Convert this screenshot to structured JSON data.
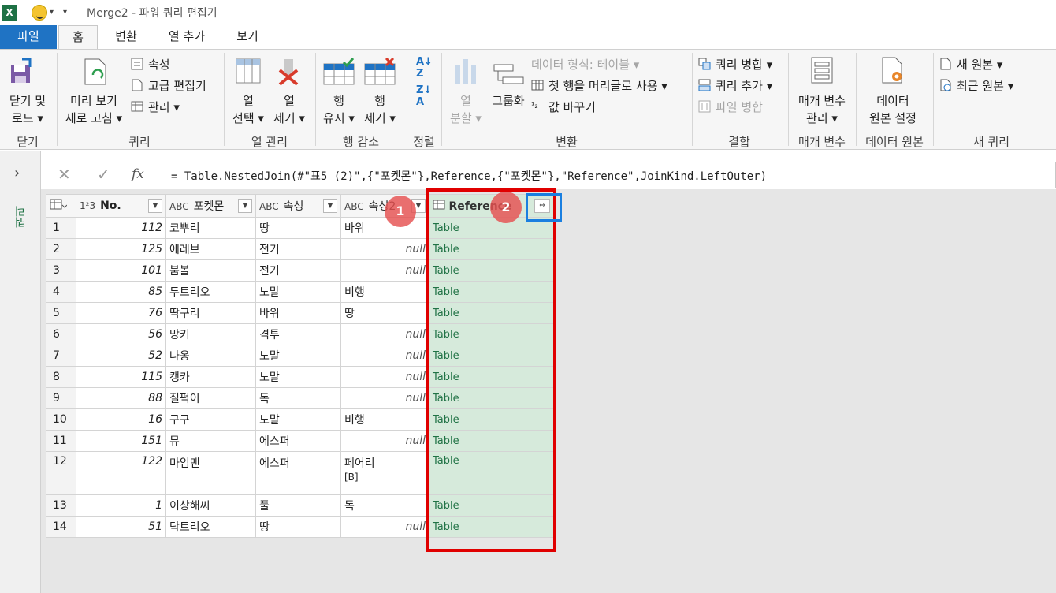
{
  "window": {
    "title": "Merge2 - 파워 쿼리 편집기"
  },
  "tabs": [
    {
      "label": "파일"
    },
    {
      "label": "홈"
    },
    {
      "label": "변환"
    },
    {
      "label": "열 추가"
    },
    {
      "label": "보기"
    }
  ],
  "ribbon": {
    "close_group": {
      "btn_line1": "닫기 및",
      "btn_line2": "로드 ▾",
      "label": "닫기"
    },
    "query_group": {
      "refresh_line1": "미리 보기",
      "refresh_line2": "새로 고침 ▾",
      "properties": "속성",
      "advanced_editor": "고급 편집기",
      "manage": "관리 ▾",
      "label": "쿼리"
    },
    "columns_group": {
      "choose_line1": "열",
      "choose_line2": "선택 ▾",
      "remove_line1": "열",
      "remove_line2": "제거 ▾",
      "label": "열 관리"
    },
    "rows_group": {
      "keep_line1": "행",
      "keep_line2": "유지 ▾",
      "remove_line1": "행",
      "remove_line2": "제거 ▾",
      "label": "행 감소"
    },
    "sort_group": {
      "label": "정렬"
    },
    "transform_group": {
      "split_line1": "열",
      "split_line2": "분할 ▾",
      "group_by": "그룹화",
      "data_type": "데이터 형식: 테이블 ▾",
      "first_row_headers": "첫 행을 머리글로 사용 ▾",
      "replace_values": "값 바꾸기",
      "label": "변환"
    },
    "combine_group": {
      "merge_queries": "쿼리 병합 ▾",
      "append_queries": "쿼리 추가 ▾",
      "combine_files": "파일 병합",
      "label": "결합"
    },
    "params_group": {
      "btn_line1": "매개 변수",
      "btn_line2": "관리 ▾",
      "label": "매개 변수"
    },
    "datasource_group": {
      "btn_line1": "데이터",
      "btn_line2": "원본 설정",
      "label": "데이터 원본"
    },
    "newquery_group": {
      "new_source": "새 원본 ▾",
      "recent_sources": "최근 원본 ▾",
      "label": "새 쿼리"
    }
  },
  "left_pane": {
    "label": "쿼리"
  },
  "formula_bar": {
    "fx": "fx",
    "formula": "= Table.NestedJoin(#\"표5 (2)\",{\"포켓몬\"},Reference,{\"포켓몬\"},\"Reference\",JoinKind.LeftOuter)"
  },
  "grid": {
    "columns": [
      {
        "type": "1²3",
        "name": "No."
      },
      {
        "type": "ABC",
        "name": "포켓몬"
      },
      {
        "type": "ABC",
        "name": "속성"
      },
      {
        "type": "ABC",
        "name": "속성2"
      },
      {
        "type": "table",
        "name": "Reference"
      }
    ],
    "rows": [
      {
        "n": "1",
        "no": "112",
        "poke": "코뿌리",
        "a1": "땅",
        "a2": "바위",
        "ref": "Table"
      },
      {
        "n": "2",
        "no": "125",
        "poke": "에레브",
        "a1": "전기",
        "a2": "null",
        "ref": "Table"
      },
      {
        "n": "3",
        "no": "101",
        "poke": "붐볼",
        "a1": "전기",
        "a2": "null",
        "ref": "Table"
      },
      {
        "n": "4",
        "no": "85",
        "poke": "두트리오",
        "a1": "노말",
        "a2": "비행",
        "ref": "Table"
      },
      {
        "n": "5",
        "no": "76",
        "poke": "딱구리",
        "a1": "바위",
        "a2": "땅",
        "ref": "Table"
      },
      {
        "n": "6",
        "no": "56",
        "poke": "망키",
        "a1": "격투",
        "a2": "null",
        "ref": "Table"
      },
      {
        "n": "7",
        "no": "52",
        "poke": "나옹",
        "a1": "노말",
        "a2": "null",
        "ref": "Table"
      },
      {
        "n": "8",
        "no": "115",
        "poke": "캥카",
        "a1": "노말",
        "a2": "null",
        "ref": "Table"
      },
      {
        "n": "9",
        "no": "88",
        "poke": "질퍽이",
        "a1": "독",
        "a2": "null",
        "ref": "Table"
      },
      {
        "n": "10",
        "no": "16",
        "poke": "구구",
        "a1": "노말",
        "a2": "비행",
        "ref": "Table"
      },
      {
        "n": "11",
        "no": "151",
        "poke": "뮤",
        "a1": "에스퍼",
        "a2": "null",
        "ref": "Table"
      },
      {
        "n": "12",
        "no": "122",
        "poke": "마임맨",
        "a1": "에스퍼",
        "a2": "페어리 [B]",
        "ref": "Table"
      },
      {
        "n": "13",
        "no": "1",
        "poke": "이상해씨",
        "a1": "풀",
        "a2": "독",
        "ref": "Table"
      },
      {
        "n": "14",
        "no": "51",
        "poke": "닥트리오",
        "a1": "땅",
        "a2": "null",
        "ref": "Table"
      }
    ]
  },
  "annotations": {
    "badge1": "1",
    "badge2": "2"
  }
}
